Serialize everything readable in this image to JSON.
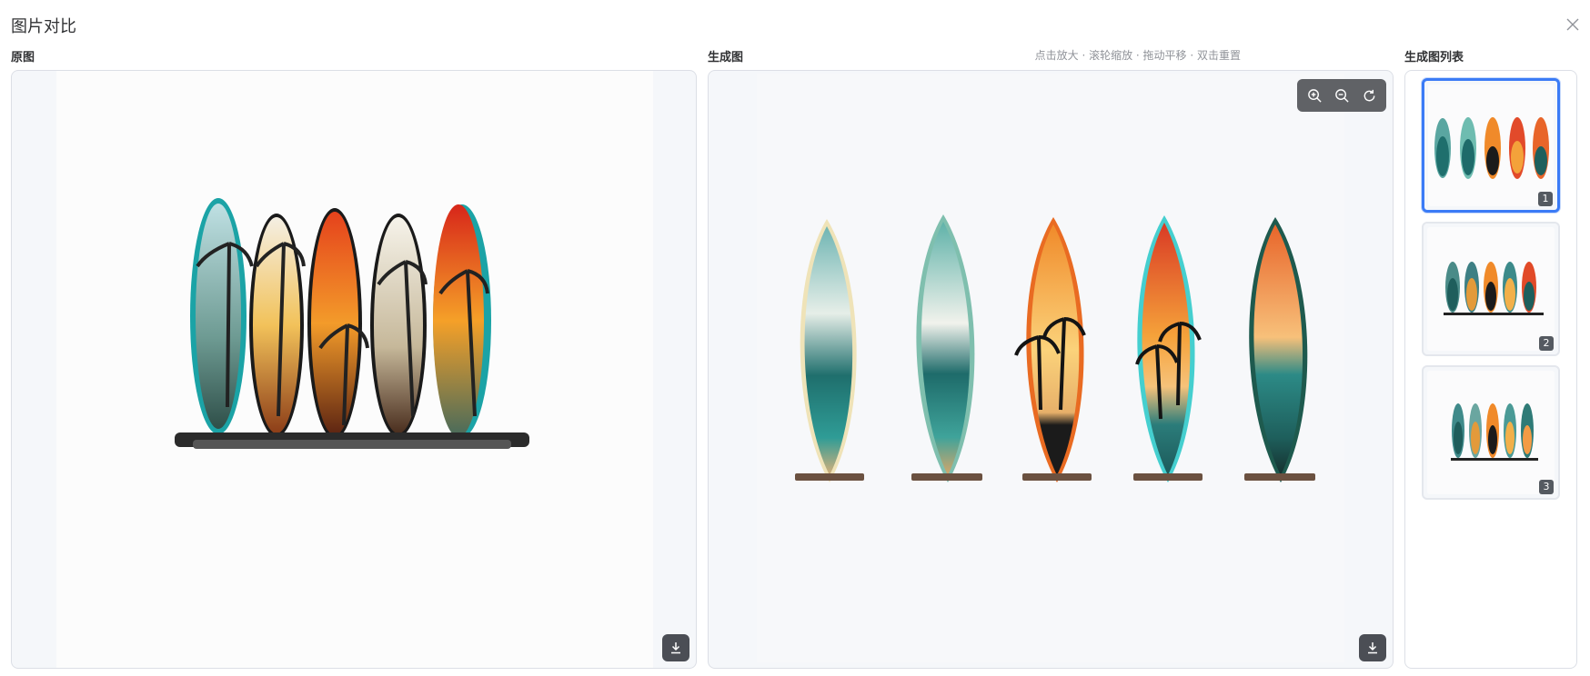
{
  "dialog": {
    "title": "图片对比",
    "close_icon": "close-icon"
  },
  "original": {
    "label": "原图"
  },
  "generated": {
    "label": "生成图",
    "hint": "点击放大 · 滚轮缩放 · 拖动平移 · 双击重置",
    "toolbar": [
      "zoom-in-icon",
      "zoom-out-icon",
      "reset-icon"
    ]
  },
  "list": {
    "label": "生成图列表",
    "thumbnails": [
      {
        "badge": "1",
        "selected": true
      },
      {
        "badge": "2",
        "selected": false
      },
      {
        "badge": "3",
        "selected": false
      }
    ]
  },
  "colors": {
    "accent": "#3b7bf6",
    "toolbar_bg": "#606266",
    "border": "#dcdfe6"
  }
}
